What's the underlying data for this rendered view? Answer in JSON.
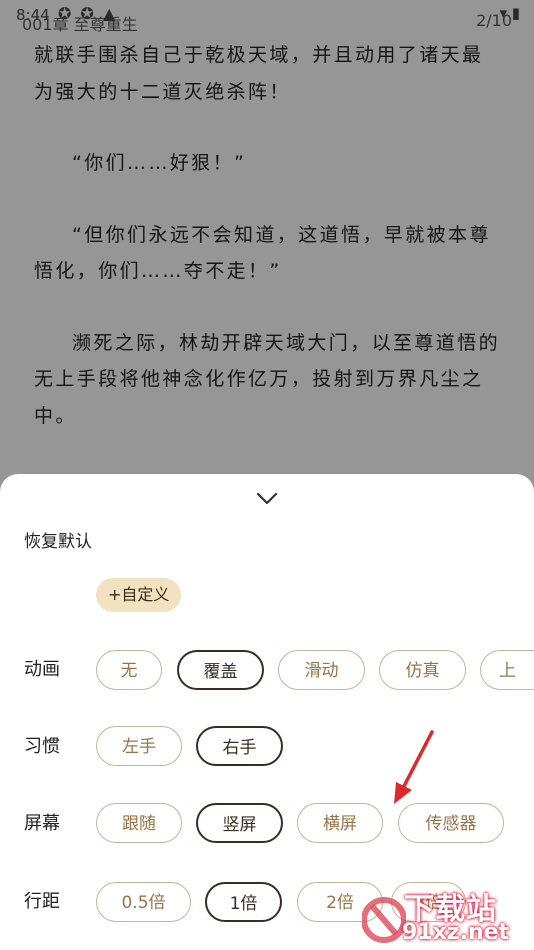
{
  "status": {
    "time": "8:44",
    "icons": "✪ ✪ ▲",
    "right": "▾ ▮"
  },
  "reader": {
    "chapter_title": "001章 至尊重生",
    "page_indicator": "2/10",
    "paragraphs": [
      "就联手围杀自己于乾极天域，并且动用了诸天最为强大的十二道灭绝杀阵！",
      "“你们……好狠！”",
      "“但你们永远不会知道，这道悟，早就被本尊悟化，你们……夺不走！”",
      "濒死之际，林劫开辟天域大门，以至尊道悟的无上手段将他神念化作亿万，投射到万界凡尘之中。"
    ]
  },
  "sheet": {
    "restore_label": "恢复默认",
    "custom_label": "+自定义",
    "rows": {
      "animation": {
        "label": "动画",
        "options": [
          "无",
          "覆盖",
          "滑动",
          "仿真",
          "上"
        ],
        "selected": "覆盖"
      },
      "habit": {
        "label": "习惯",
        "options": [
          "左手",
          "右手"
        ],
        "selected": "右手"
      },
      "screen": {
        "label": "屏幕",
        "options": [
          "跟随",
          "竖屏",
          "横屏",
          "传感器"
        ],
        "selected": "竖屏"
      },
      "spacing": {
        "label": "行距",
        "options": [
          "0.5倍",
          "1倍",
          "2倍",
          "3倍"
        ],
        "selected": "1倍"
      }
    }
  },
  "watermark": {
    "text": "下载站",
    "url": "91xz.net"
  },
  "colors": {
    "accent": "#9a7448",
    "chip_border": "#c9b397",
    "selected": "#3a2d20",
    "custom_bg": "#f3e2c2"
  }
}
